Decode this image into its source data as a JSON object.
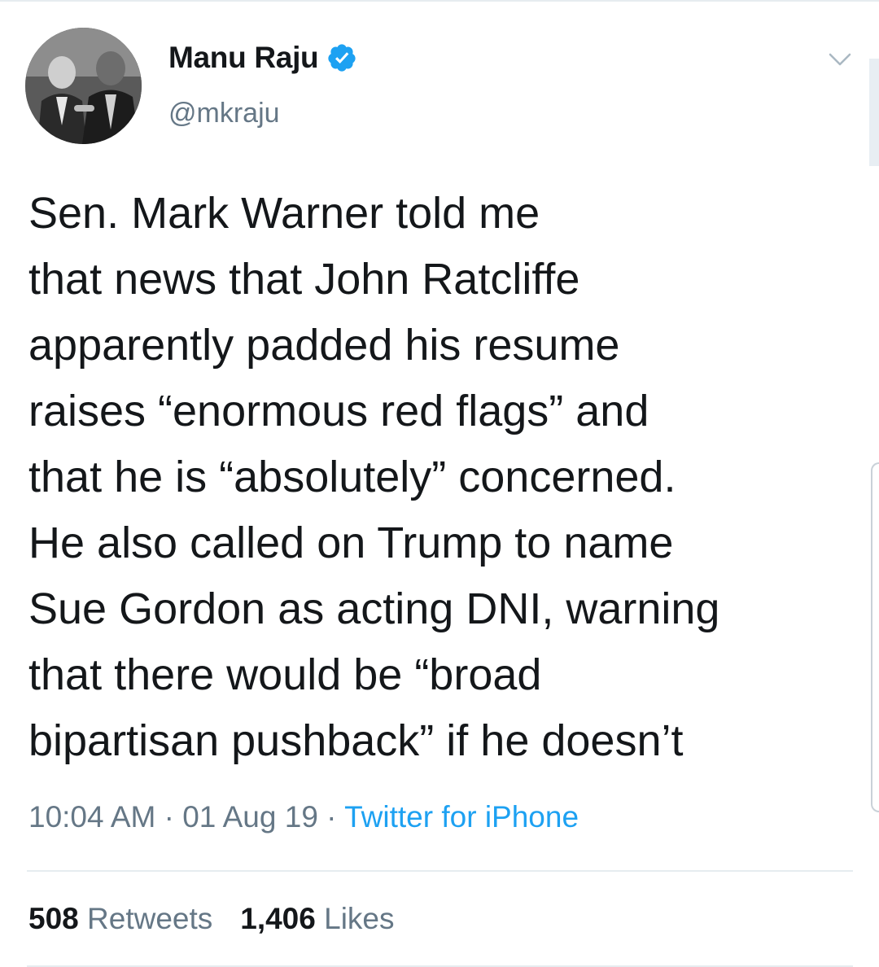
{
  "tweet": {
    "author": {
      "display_name": "Manu Raju",
      "handle": "@mkraju",
      "verified": true
    },
    "text_lines": [
      "Sen. Mark Warner told me",
      "that news that John Ratcliffe",
      "apparently padded his resume",
      "raises “enormous red flags” and",
      "that he is “absolutely” concerned.",
      "He also called on Trump to name",
      "Sue Gordon as acting DNI, warning",
      "that there would be “broad",
      "bipartisan pushback” if he doesn’t"
    ],
    "time": "10:04 AM",
    "separator": " · ",
    "date": "01 Aug 19",
    "source": "Twitter for iPhone",
    "stats": {
      "retweets_count": "508",
      "retweets_label": "Retweets",
      "likes_count": "1,406",
      "likes_label": "Likes"
    }
  },
  "icons": {
    "verified": "verified-badge-icon",
    "menu": "chevron-down-icon"
  },
  "colors": {
    "text": "#14171a",
    "secondary": "#657786",
    "link": "#1da1f2",
    "verified": "#1da1f2",
    "divider": "#e6ecf0"
  }
}
